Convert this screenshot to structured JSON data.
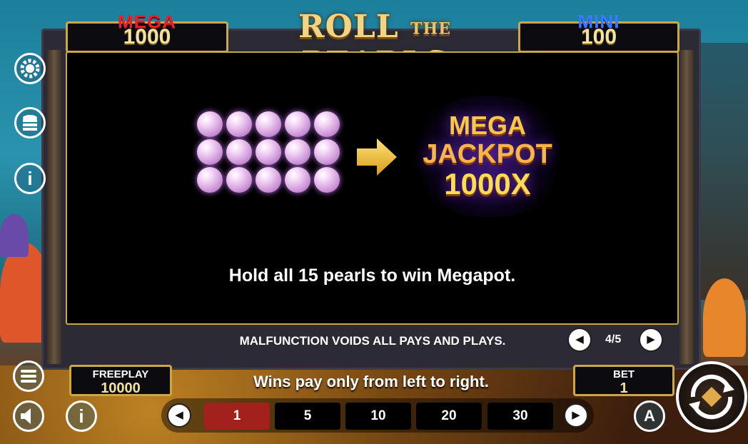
{
  "game": {
    "logo_text_left": "ROLL",
    "logo_text_mid": "THE",
    "logo_text_right": "PEARLS"
  },
  "jackpots": {
    "mega": {
      "label": "MEGA",
      "value": "1000",
      "label_color": "#e8212b"
    },
    "mini": {
      "label": "MINI",
      "value": "100",
      "label_color": "#2f6cf0"
    }
  },
  "info_page": {
    "prize_lines": [
      "MEGA",
      "JACKPOT",
      "1000X"
    ],
    "description": "Hold all 15 pearls to win Megapot.",
    "pearl_count": 15
  },
  "footer": {
    "malfunction_notice": "MALFUNCTION VOIDS ALL PAYS AND PLAYS.",
    "pager": "4/5",
    "wins_notice": "Wins pay only from left to right."
  },
  "freeplay": {
    "label": "FREEPLAY",
    "value": "10000"
  },
  "bet": {
    "label": "BET",
    "value": "1"
  },
  "bet_options": [
    "1",
    "5",
    "10",
    "20",
    "30"
  ],
  "selected_bet": "1",
  "icons": {
    "settings": "gear-icon",
    "coins": "coin-stack-icon",
    "info": "info-icon",
    "menu": "menu-icon",
    "sound": "speaker-icon",
    "autoplay": "autoplay-icon",
    "spin": "spin-icon"
  },
  "colors": {
    "frame_gold": "#caa74a",
    "selected_bet_bg": "#a2211d",
    "jackpot_gold": "#f6c94a"
  }
}
